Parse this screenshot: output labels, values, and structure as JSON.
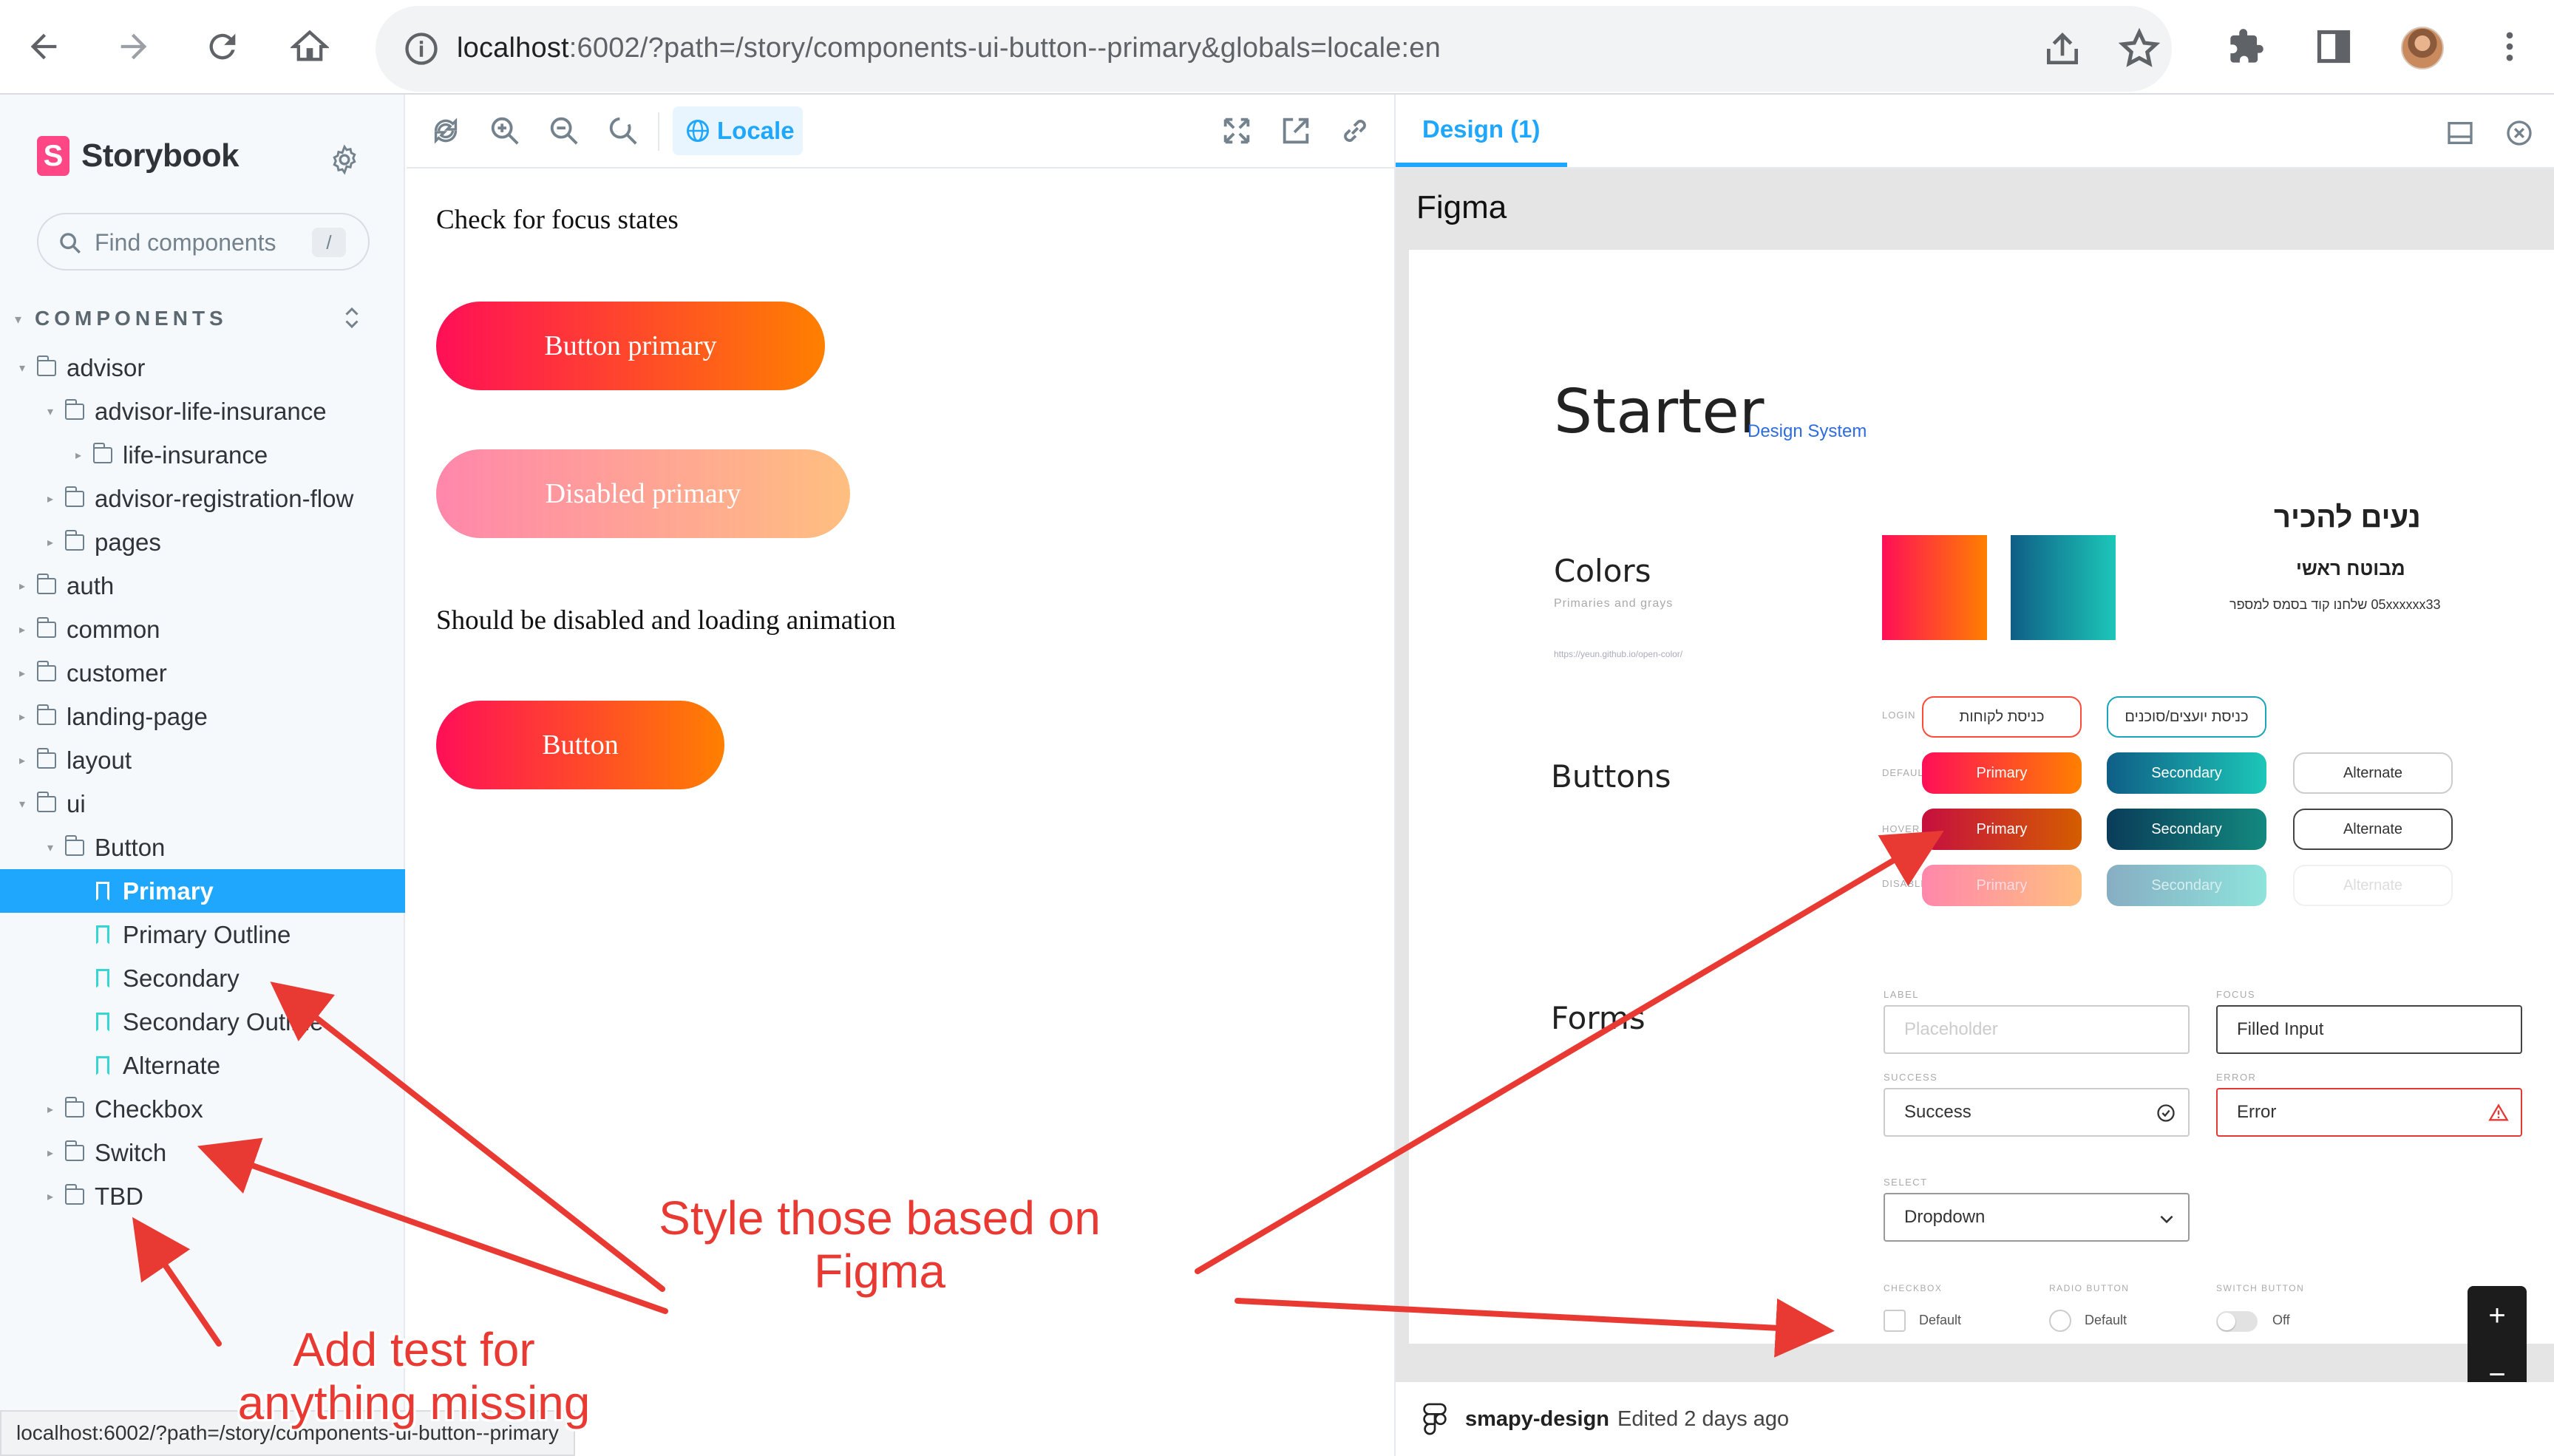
{
  "browser": {
    "url_host": "localhost",
    "url_rest": ":6002/?path=/story/components-ui-button--primary&globals=locale:en",
    "status_url": "localhost:6002/?path=/story/components-ui-button--primary"
  },
  "sidebar": {
    "brand": "Storybook",
    "search_placeholder": "Find components",
    "search_shortcut": "/",
    "section_title": "COMPONENTS",
    "items": [
      {
        "label": "advisor"
      },
      {
        "label": "advisor-life-insurance"
      },
      {
        "label": "life-insurance"
      },
      {
        "label": "advisor-registration-flow"
      },
      {
        "label": "pages"
      },
      {
        "label": "auth"
      },
      {
        "label": "common"
      },
      {
        "label": "customer"
      },
      {
        "label": "landing-page"
      },
      {
        "label": "layout"
      },
      {
        "label": "ui"
      },
      {
        "label": "Button"
      },
      {
        "label": "Primary"
      },
      {
        "label": "Primary Outline"
      },
      {
        "label": "Secondary"
      },
      {
        "label": "Secondary Outline"
      },
      {
        "label": "Alternate"
      },
      {
        "label": "Checkbox"
      },
      {
        "label": "Switch"
      },
      {
        "label": "TBD"
      }
    ]
  },
  "toolbar": {
    "locale_label": "Locale"
  },
  "story": {
    "focus_text": "Check for focus states",
    "button_primary": "Button primary",
    "disabled_primary": "Disabled primary",
    "loading_text": "Should be disabled and loading animation",
    "button": "Button"
  },
  "panel": {
    "tab_label": "Design (1)",
    "frame_title": "Figma",
    "file_name": "smapy-design",
    "edited": "Edited 2 days ago",
    "zoom_in": "+",
    "zoom_out": "−"
  },
  "figma_board": {
    "title": "Starter",
    "subtitle": "Design System",
    "colors_heading": "Colors",
    "colors_sub": "Primaries and grays",
    "colors_link": "https://yeun.github.io/open-color/",
    "hebrew_title": "נעים להכיר",
    "hebrew_sub": "מבוטח ראשי",
    "hebrew_phone": "05xxxxxx33 שלחנו קוד בסמס למספר",
    "buttons_heading": "Buttons",
    "forms_heading": "Forms",
    "row_labels": {
      "login": "LOGIN",
      "default": "DEFAULT",
      "hover": "HOVER",
      "disabled": "DISABLED"
    },
    "login_btn_1": "כניסת לקוחות",
    "login_btn_2": "כניסת יועצים/סוכנים",
    "btn_primary": "Primary",
    "btn_secondary": "Secondary",
    "btn_alternate": "Alternate",
    "form_labels": {
      "label": "LABEL",
      "focus": "FOCUS",
      "success": "SUCCESS",
      "error": "ERROR",
      "select": "SELECT",
      "checkbox": "CHECKBOX",
      "radio": "RADIO BUTTON",
      "switch": "SWITCH BUTTON"
    },
    "input_placeholder": "Placeholder",
    "input_filled": "Filled Input",
    "input_success": "Success",
    "input_error": "Error",
    "dropdown": "Dropdown",
    "checkbox_default": "Default",
    "radio_default": "Default",
    "switch_off": "Off"
  },
  "annotations": {
    "style_note_line1": "Style those based on",
    "style_note_line2": "Figma",
    "test_note_line1": "Add test for",
    "test_note_line2": "anything missing"
  },
  "colors": {
    "storybook_pink": "#ff4785",
    "storybook_blue": "#1ea7fd",
    "primary_start": "#ff0f57",
    "primary_end": "#ff8000",
    "secondary_start": "#0f5e86",
    "secondary_end": "#1cc7b8",
    "annotation_red": "#e83a33"
  }
}
